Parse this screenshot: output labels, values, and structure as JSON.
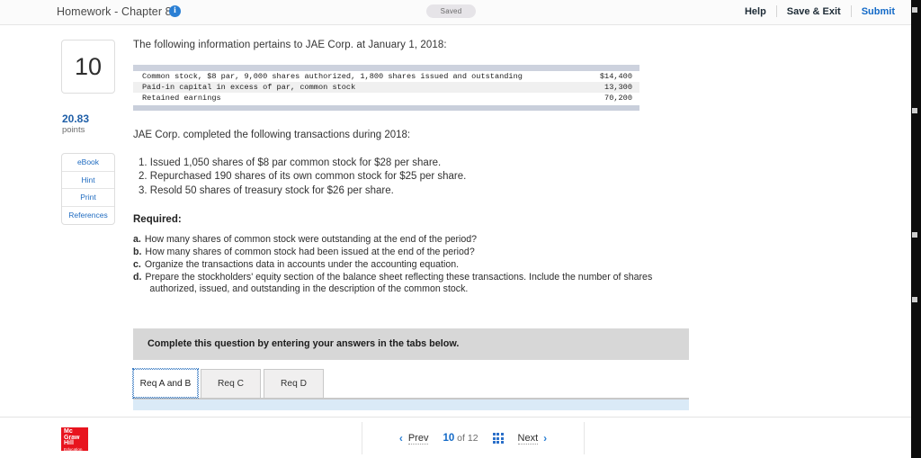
{
  "topbar": {
    "title": "Homework - Chapter 8",
    "info_icon": "info-icon",
    "saved_badge": "Saved",
    "help": "Help",
    "save_exit": "Save & Exit",
    "submit": "Submit"
  },
  "rail": {
    "question_number": "10",
    "points_value": "20.83",
    "points_label": "points",
    "buttons": [
      {
        "label": "eBook"
      },
      {
        "label": "Hint"
      },
      {
        "label": "Print"
      },
      {
        "label": "References"
      }
    ]
  },
  "question": {
    "lead": "The following information pertains to JAE Corp. at January 1, 2018:",
    "balance_table": {
      "rows": [
        {
          "label": "Common stock, $8 par, 9,000 shares authorized, 1,800 shares issued and outstanding",
          "amount": "$14,400"
        },
        {
          "label": "Paid-in capital in excess of par, common stock",
          "amount": "13,300"
        },
        {
          "label": "Retained earnings",
          "amount": "70,200"
        }
      ]
    },
    "sub_lead": "JAE Corp. completed the following transactions during 2018:",
    "transactions": [
      "1. Issued 1,050 shares of $8 par common stock for $28 per share.",
      "2. Repurchased 190 shares of its own common stock for $25 per share.",
      "3. Resold 50 shares of treasury stock for $26 per share."
    ],
    "required_heading": "Required:",
    "requirements": [
      {
        "letter": "a.",
        "text": "How many shares of common stock were outstanding at the end of the period?",
        "cont": ""
      },
      {
        "letter": "b.",
        "text": "How many shares of common stock had been issued at the end of the period?",
        "cont": ""
      },
      {
        "letter": "c.",
        "text": "Organize the transactions data in accounts under the accounting equation.",
        "cont": ""
      },
      {
        "letter": "d.",
        "text": "Prepare the stockholders' equity section of the balance sheet reflecting these transactions. Include the number of shares",
        "cont": "authorized, issued, and outstanding in the description of the common stock."
      }
    ]
  },
  "answer_area": {
    "instruction": "Complete this question by entering your answers in the tabs below.",
    "tabs": [
      {
        "label": "Req A and B",
        "active": true
      },
      {
        "label": "Req C",
        "active": false
      },
      {
        "label": "Req D",
        "active": false
      }
    ]
  },
  "footer": {
    "logo": {
      "line1": "Mc",
      "line2": "Graw",
      "line3": "Hill",
      "line4": "Education",
      "color": "#e8141e"
    },
    "prev_label": "Prev",
    "next_label": "Next",
    "current_page": "10",
    "of_label": "of",
    "total_pages": "12",
    "grid_icon": "grid-icon",
    "prev_icon": "chevron-left-icon",
    "next_icon": "chevron-right-icon"
  }
}
